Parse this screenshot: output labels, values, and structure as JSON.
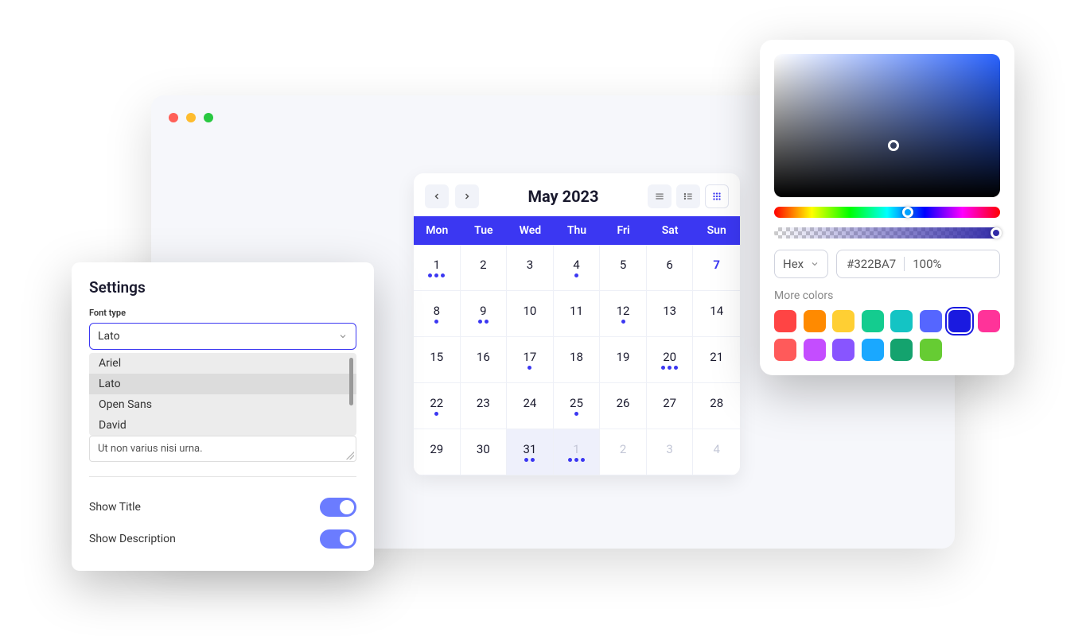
{
  "calendar": {
    "title": "May 2023",
    "days": [
      "Mon",
      "Tue",
      "Wed",
      "Thu",
      "Fri",
      "Sat",
      "Sun"
    ],
    "cells": [
      {
        "n": "1",
        "dots": 3
      },
      {
        "n": "2"
      },
      {
        "n": "3"
      },
      {
        "n": "4",
        "dots": 1
      },
      {
        "n": "5"
      },
      {
        "n": "6"
      },
      {
        "n": "7",
        "today": true
      },
      {
        "n": "8",
        "dots": 1
      },
      {
        "n": "9",
        "dots": 2
      },
      {
        "n": "10"
      },
      {
        "n": "11"
      },
      {
        "n": "12",
        "dots": 1
      },
      {
        "n": "13"
      },
      {
        "n": "14"
      },
      {
        "n": "15"
      },
      {
        "n": "16"
      },
      {
        "n": "17",
        "dots": 1
      },
      {
        "n": "18"
      },
      {
        "n": "19"
      },
      {
        "n": "20",
        "dots": 3
      },
      {
        "n": "21"
      },
      {
        "n": "22",
        "dots": 1
      },
      {
        "n": "23"
      },
      {
        "n": "24"
      },
      {
        "n": "25",
        "dots": 1
      },
      {
        "n": "26"
      },
      {
        "n": "27"
      },
      {
        "n": "28"
      },
      {
        "n": "29"
      },
      {
        "n": "30"
      },
      {
        "n": "31",
        "dots": 2,
        "sel": true
      },
      {
        "n": "1",
        "dots": 3,
        "sel": true,
        "muted": true
      },
      {
        "n": "2",
        "muted": true
      },
      {
        "n": "3",
        "muted": true
      },
      {
        "n": "4",
        "muted": true
      }
    ]
  },
  "settings": {
    "title": "Settings",
    "font_label": "Font type",
    "font_selected": "Lato",
    "font_options": [
      "Ariel",
      "Lato",
      "Open Sans",
      "David"
    ],
    "textarea": "Ut non varius nisi urna.",
    "show_title": "Show Title",
    "show_description": "Show Description"
  },
  "picker": {
    "format": "Hex",
    "hex": "#322BA7",
    "opacity": "100%",
    "more_label": "More colors",
    "swatches": [
      "#ff4444",
      "#ff8a00",
      "#ffcf33",
      "#14cc8f",
      "#14c4c4",
      "#5566ff",
      "#1a1ae0",
      "#ff3399",
      "#ff5a5a",
      "#c44dff",
      "#8855ff",
      "#1aa8ff",
      "#14a36e",
      "#66cc33"
    ],
    "selected_swatch": 6
  }
}
